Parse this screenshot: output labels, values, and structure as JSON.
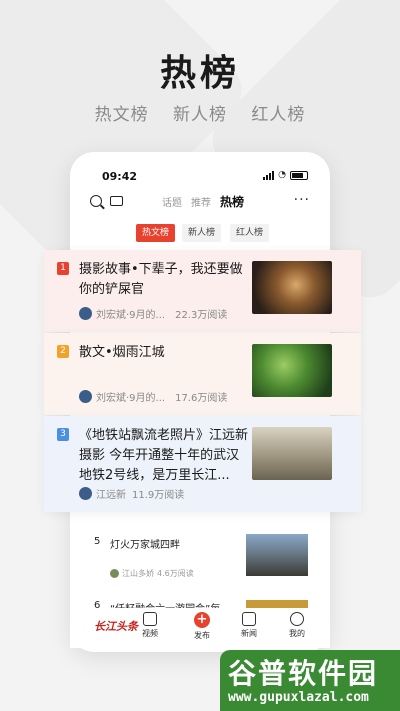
{
  "headline": "热榜",
  "subheadline": [
    "热文榜",
    "新人榜",
    "红人榜"
  ],
  "phone": {
    "status_time": "09:42",
    "topbar_tabs": [
      "话题",
      "推荐",
      "热榜"
    ],
    "active_tab": "热榜",
    "more": "···",
    "subtabs": [
      "热文榜",
      "新人榜",
      "红人榜"
    ]
  },
  "cards": [
    {
      "rank": "1",
      "title": "摄影故事•下辈子，我还要做你的铲屎官",
      "author": "刘宏斌·9月的...",
      "reads": "22.3万阅读"
    },
    {
      "rank": "2",
      "title": "散文•烟雨江城",
      "author": "刘宏斌·9月的...",
      "reads": "17.6万阅读"
    },
    {
      "rank": "3",
      "title": "《地铁站飘流老照片》江远新摄影 今年开通整十年的武汉地铁2号线，是万里长江...",
      "author": "江远新",
      "reads": "11.9万阅读"
    }
  ],
  "list_items": [
    {
      "num": "5",
      "title": "灯火万家城四畔",
      "author": "江山多娇",
      "reads": "4.6万阅读"
    },
    {
      "num": "6",
      "title": "“仟籽融合六一游园会”每"
    }
  ],
  "navbar": {
    "logo": "长江头条",
    "items": [
      "视频",
      "发布",
      "新闻",
      "我的"
    ],
    "publish_symbol": "+"
  },
  "watermark": {
    "title": "谷普软件园",
    "url": "www.gupuxlazal.com"
  },
  "colors": {
    "accent": "#e8422e",
    "rank1": "#e8422e",
    "rank2": "#f2a12a",
    "rank3": "#4b8fe0"
  }
}
